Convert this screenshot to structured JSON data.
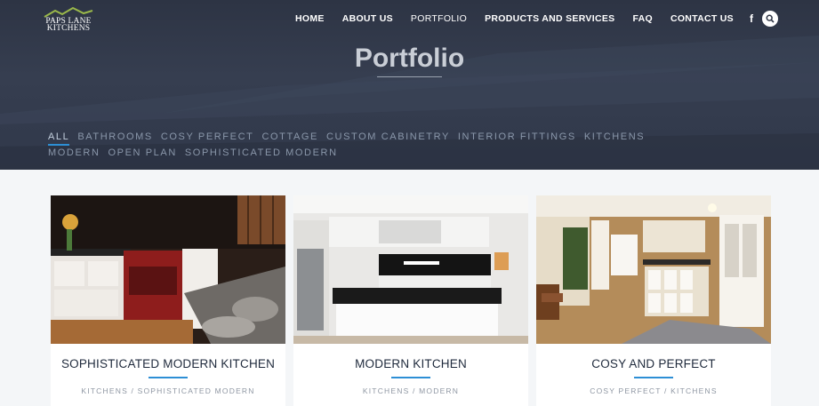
{
  "brand": {
    "logo_line1": "PAPS LANE",
    "logo_line2": "KITCHENS"
  },
  "nav": {
    "items": [
      "HOME",
      "ABOUT US",
      "PORTFOLIO",
      "PRODUCTS AND SERVICES",
      "FAQ",
      "CONTACT US"
    ],
    "active": "PORTFOLIO",
    "facebook_glyph": "f",
    "social_icon": "facebook-icon",
    "search_icon": "search-icon"
  },
  "hero": {
    "title": "Portfolio"
  },
  "filters": [
    "ALL",
    "BATHROOMS",
    "COSY PERFECT",
    "COTTAGE",
    "CUSTOM CABINETRY",
    "INTERIOR FITTINGS",
    "KITCHENS",
    "MODERN",
    "OPEN PLAN",
    "SOPHISTICATED MODERN"
  ],
  "active_filter": "ALL",
  "cards": [
    {
      "title": "SOPHISTICATED MODERN KITCHEN",
      "tags": "KITCHENS / SOPHISTICATED MODERN"
    },
    {
      "title": "MODERN KITCHEN",
      "tags": "KITCHENS / MODERN"
    },
    {
      "title": "COSY AND PERFECT",
      "tags": "COSY PERFECT / KITCHENS"
    }
  ],
  "colors": {
    "hero_bg": "#323a4c",
    "accent": "#2d8fd5",
    "page_bg": "#f4f6f8",
    "card_title": "#1f2a3c"
  }
}
